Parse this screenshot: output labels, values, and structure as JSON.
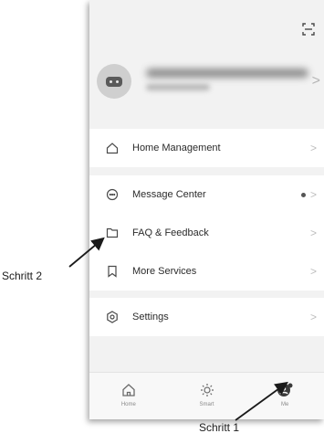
{
  "menu": {
    "home_management": "Home Management",
    "message_center": "Message Center",
    "faq_feedback": "FAQ & Feedback",
    "more_services": "More Services",
    "settings": "Settings",
    "chevron": ">"
  },
  "tabs": {
    "home": "Home",
    "smart": "Smart",
    "me": "Me"
  },
  "callouts": {
    "step1": "Schritt 1",
    "step2": "Schritt 2"
  },
  "icons": {
    "scan": "scan-icon",
    "home_management": "house-outline-icon",
    "message_center": "chat-bubble-icon",
    "faq": "folder-icon",
    "more_services": "bookmark-icon",
    "settings": "hexagon-gear-icon",
    "tab_home": "home-icon",
    "tab_smart": "sun-icon",
    "tab_me": "person-icon"
  },
  "colors": {
    "background": "#f2f2f2",
    "card": "#ffffff",
    "text": "#2b2b2b",
    "chevron": "#bdbdbd",
    "tab_active": "#3a3a3a",
    "tab_inactive": "#8a8a8a"
  }
}
